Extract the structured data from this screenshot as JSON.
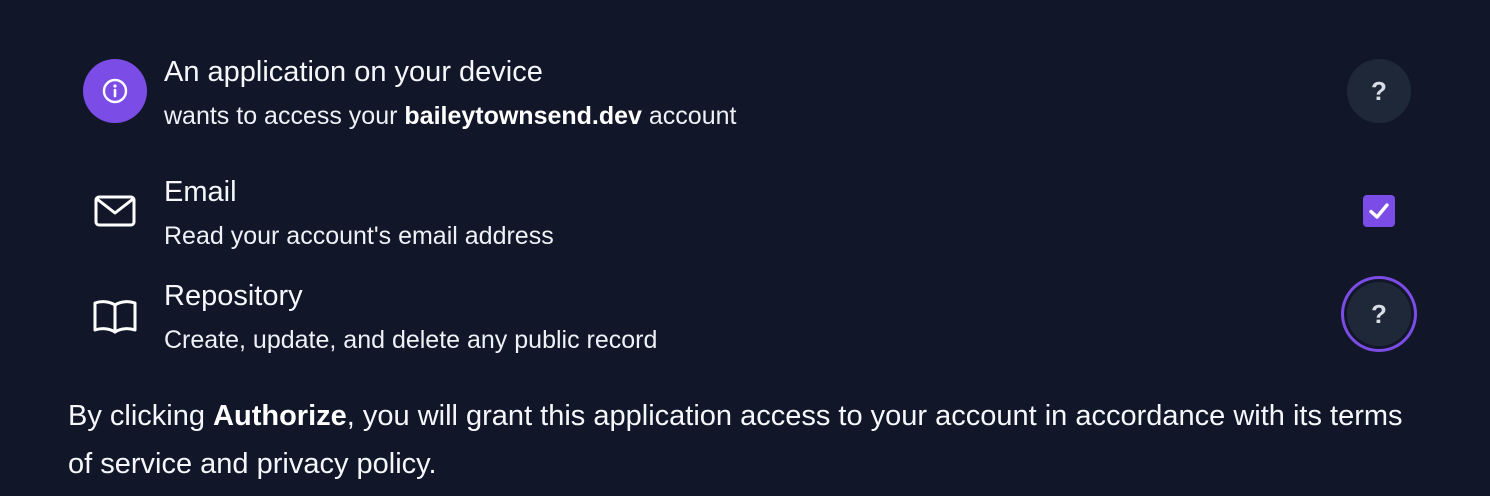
{
  "app_request": {
    "title": "An application on your device",
    "desc_prefix": "wants to access your ",
    "account_handle": "baileytownsend.dev",
    "desc_suffix": " account",
    "help_label": "?",
    "icon": "info-icon"
  },
  "permissions": [
    {
      "title": "Email",
      "description": "Read your account's email address",
      "icon": "mail-icon",
      "checked": true
    },
    {
      "title": "Repository",
      "description": "Create, update, and delete any public record",
      "icon": "book-icon",
      "help_label": "?"
    }
  ],
  "footer": {
    "prefix": "By clicking ",
    "emphasis": "Authorize",
    "suffix": ", you will grant this application access to your account in accordance with its terms of service and privacy policy."
  },
  "colors": {
    "background": "#111729",
    "accent": "#7c4ce6",
    "button_bg": "#1f2839"
  }
}
